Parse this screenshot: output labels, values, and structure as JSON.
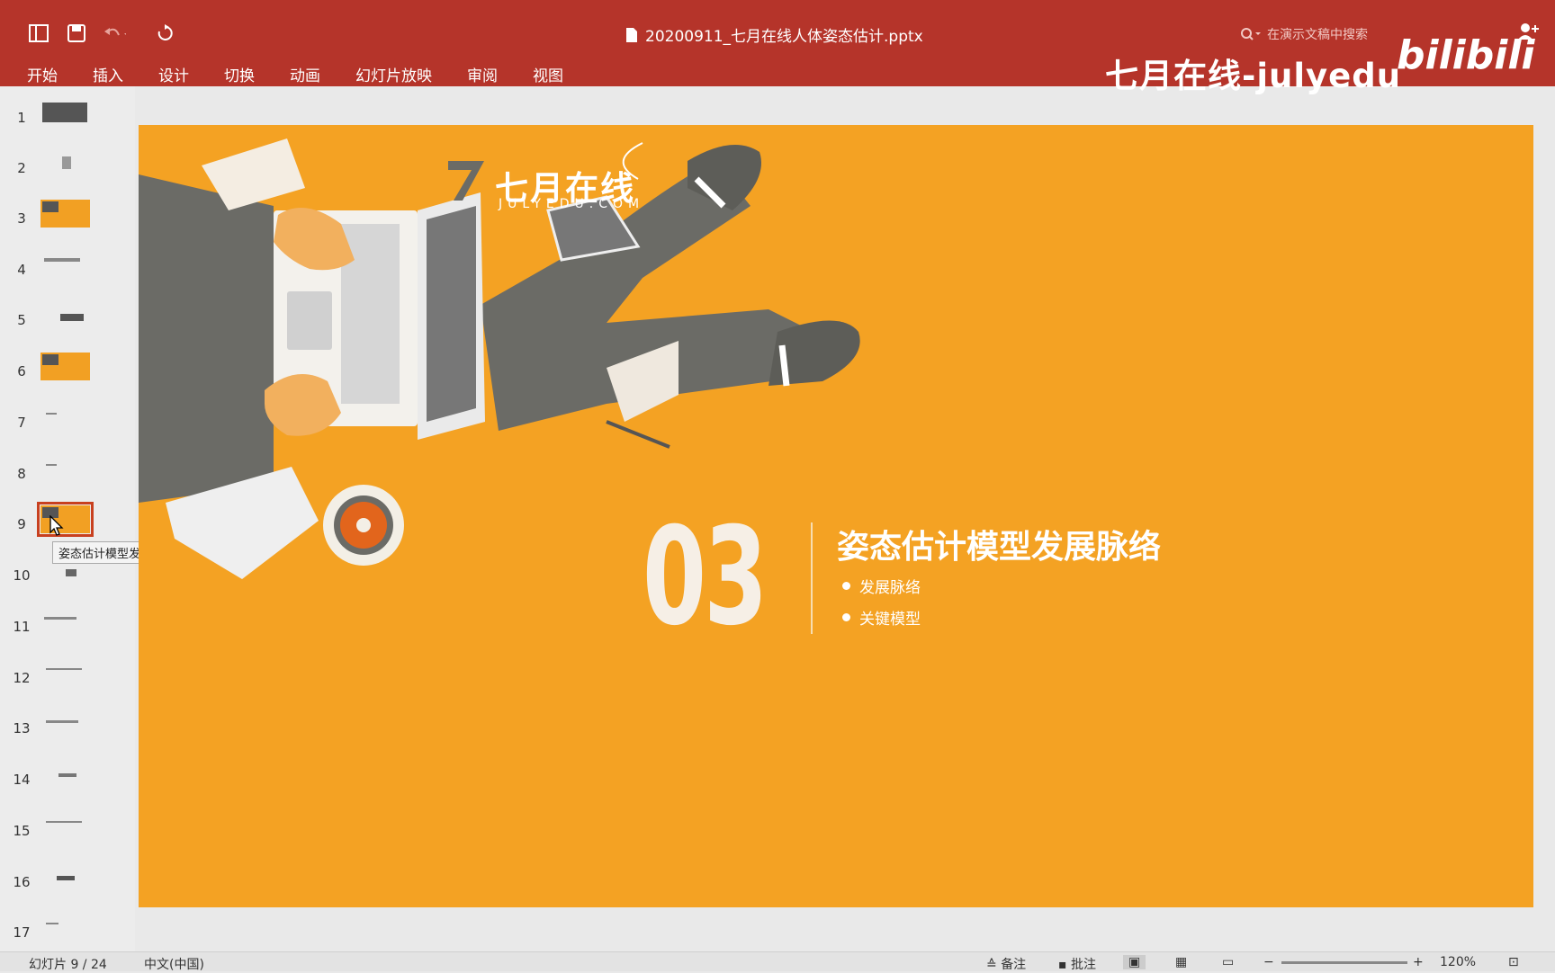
{
  "titlebar": {
    "doc_title": "20200911_七月在线人体姿态估计.pptx",
    "search_placeholder": "在演示文稿中搜索",
    "watermark": "七月在线-julyedu",
    "bilibili": "bilibili",
    "icons": [
      "sidebar-icon",
      "save-icon",
      "undo-icon",
      "redo-icon",
      "search-icon",
      "share-icon"
    ]
  },
  "ribbon": {
    "tabs": [
      "开始",
      "插入",
      "设计",
      "切换",
      "动画",
      "幻灯片放映",
      "审阅",
      "视图"
    ]
  },
  "thumbnails": {
    "numbers": [
      "1",
      "2",
      "3",
      "4",
      "5",
      "6",
      "7",
      "8",
      "9",
      "10",
      "11",
      "12",
      "13",
      "14",
      "15",
      "16",
      "17"
    ],
    "selected_index": 9,
    "tooltip": "姿态估计模型发展脉络"
  },
  "slide": {
    "logo_cn": "七月在线",
    "logo_en": "JULYEDU.COM",
    "number": "03",
    "title": "姿态估计模型发展脉络",
    "bullets": [
      "发展脉络",
      "关键模型"
    ],
    "colors": {
      "background": "#f4a223",
      "accent": "#b5342a",
      "figure": "#6b6b66"
    }
  },
  "statusbar": {
    "slide_info": "幻灯片 9 / 24",
    "language": "中文(中国)",
    "notes_label": "备注",
    "comments_label": "批注",
    "zoom": "120%"
  }
}
